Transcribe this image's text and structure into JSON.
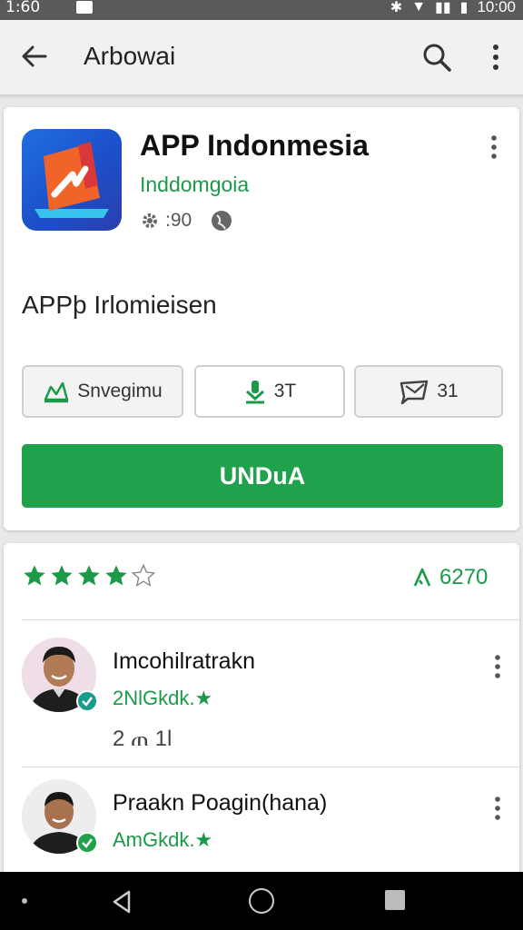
{
  "status_bar": {
    "time_left": "1:60",
    "time_right": "10:00"
  },
  "app_bar": {
    "title": "Arbowai"
  },
  "app": {
    "name": "APP Indonmesia",
    "developer": "Inddomgoia",
    "meta_value": ":90",
    "subtitle": "APPþ Irlomieisen",
    "buttons": [
      {
        "label": "Snvegimu",
        "icon": "share-icon"
      },
      {
        "label": "3T",
        "icon": "download-icon"
      },
      {
        "label": "31",
        "icon": "message-icon"
      }
    ],
    "install_label": "UNDuA"
  },
  "ratings": {
    "stars": 4,
    "count": "6270"
  },
  "reviews": [
    {
      "name": "Imcohilratrakn",
      "subtitle": "2NlGkdk.★",
      "likes": "2 ጠ 1l"
    },
    {
      "name": "Praakn Poagin(hana)",
      "subtitle": "AmGkdk.★",
      "likes": ""
    }
  ],
  "colors": {
    "accent": "#1fa24b",
    "statusbar": "#5a5a5a",
    "navbar": "#000000"
  }
}
